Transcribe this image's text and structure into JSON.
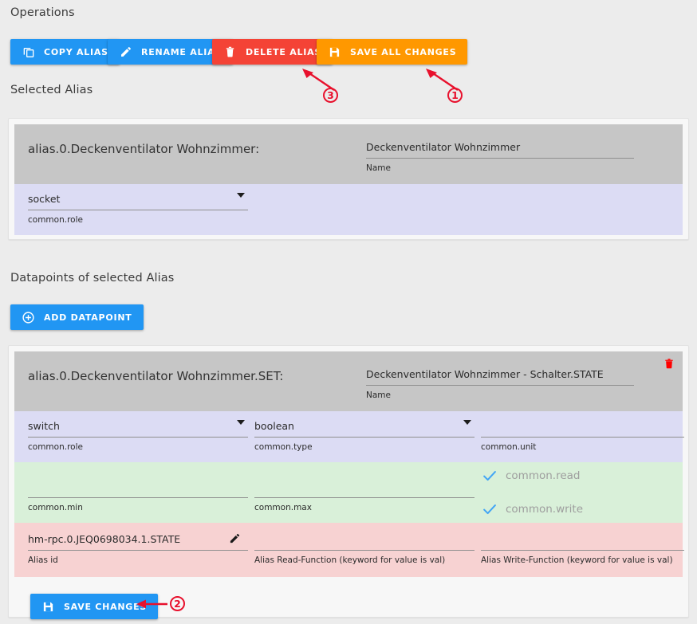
{
  "sections": {
    "operations_title": "Operations",
    "selected_alias_title": "Selected Alias",
    "datapoints_title": "Datapoints of selected Alias"
  },
  "operations": {
    "copy_alias": "COPY ALIAS",
    "rename_alias": "RENAME ALIAS",
    "delete_alias": "DELETE ALIAS",
    "save_all_changes": "SAVE ALL CHANGES"
  },
  "datapoints_toolbar": {
    "add_datapoint": "ADD DATAPOINT",
    "save_changes": "SAVE CHANGES"
  },
  "selected_alias": {
    "id_label": "alias.0.Deckenventilator Wohnzimmer:",
    "name_value": "Deckenventilator Wohnzimmer",
    "name_label": "Name",
    "role_value": "socket",
    "role_label": "common.role"
  },
  "datapoint": {
    "id_label": "alias.0.Deckenventilator Wohnzimmer.SET:",
    "name_value": "Deckenventilator Wohnzimmer - Schalter.STATE",
    "name_label": "Name",
    "role_value": "switch",
    "role_label": "common.role",
    "type_value": "boolean",
    "type_label": "common.type",
    "unit_value": "",
    "unit_label": "common.unit",
    "min_value": "",
    "min_label": "common.min",
    "max_value": "",
    "max_label": "common.max",
    "read_label": "common.read",
    "write_label": "common.write",
    "alias_id_value": "hm-rpc.0.JEQ0698034.1.STATE",
    "alias_id_label": "Alias id",
    "read_fn_value": "",
    "read_fn_label": "Alias Read-Function (keyword for value is val)",
    "write_fn_value": "",
    "write_fn_label": "Alias Write-Function (keyword for value is val)"
  },
  "annotations": {
    "one": "1",
    "two": "2",
    "three": "3"
  },
  "colors": {
    "blue": "#2196f3",
    "red": "#f44336",
    "orange": "#ff9800",
    "annotation_red": "#e8112d",
    "header_grey": "#c6c6c6",
    "role_lavender": "#dcdcf4",
    "minmax_green": "#d9f0d9",
    "alias_pink": "#f7d2d2",
    "page_background": "#ececec"
  }
}
